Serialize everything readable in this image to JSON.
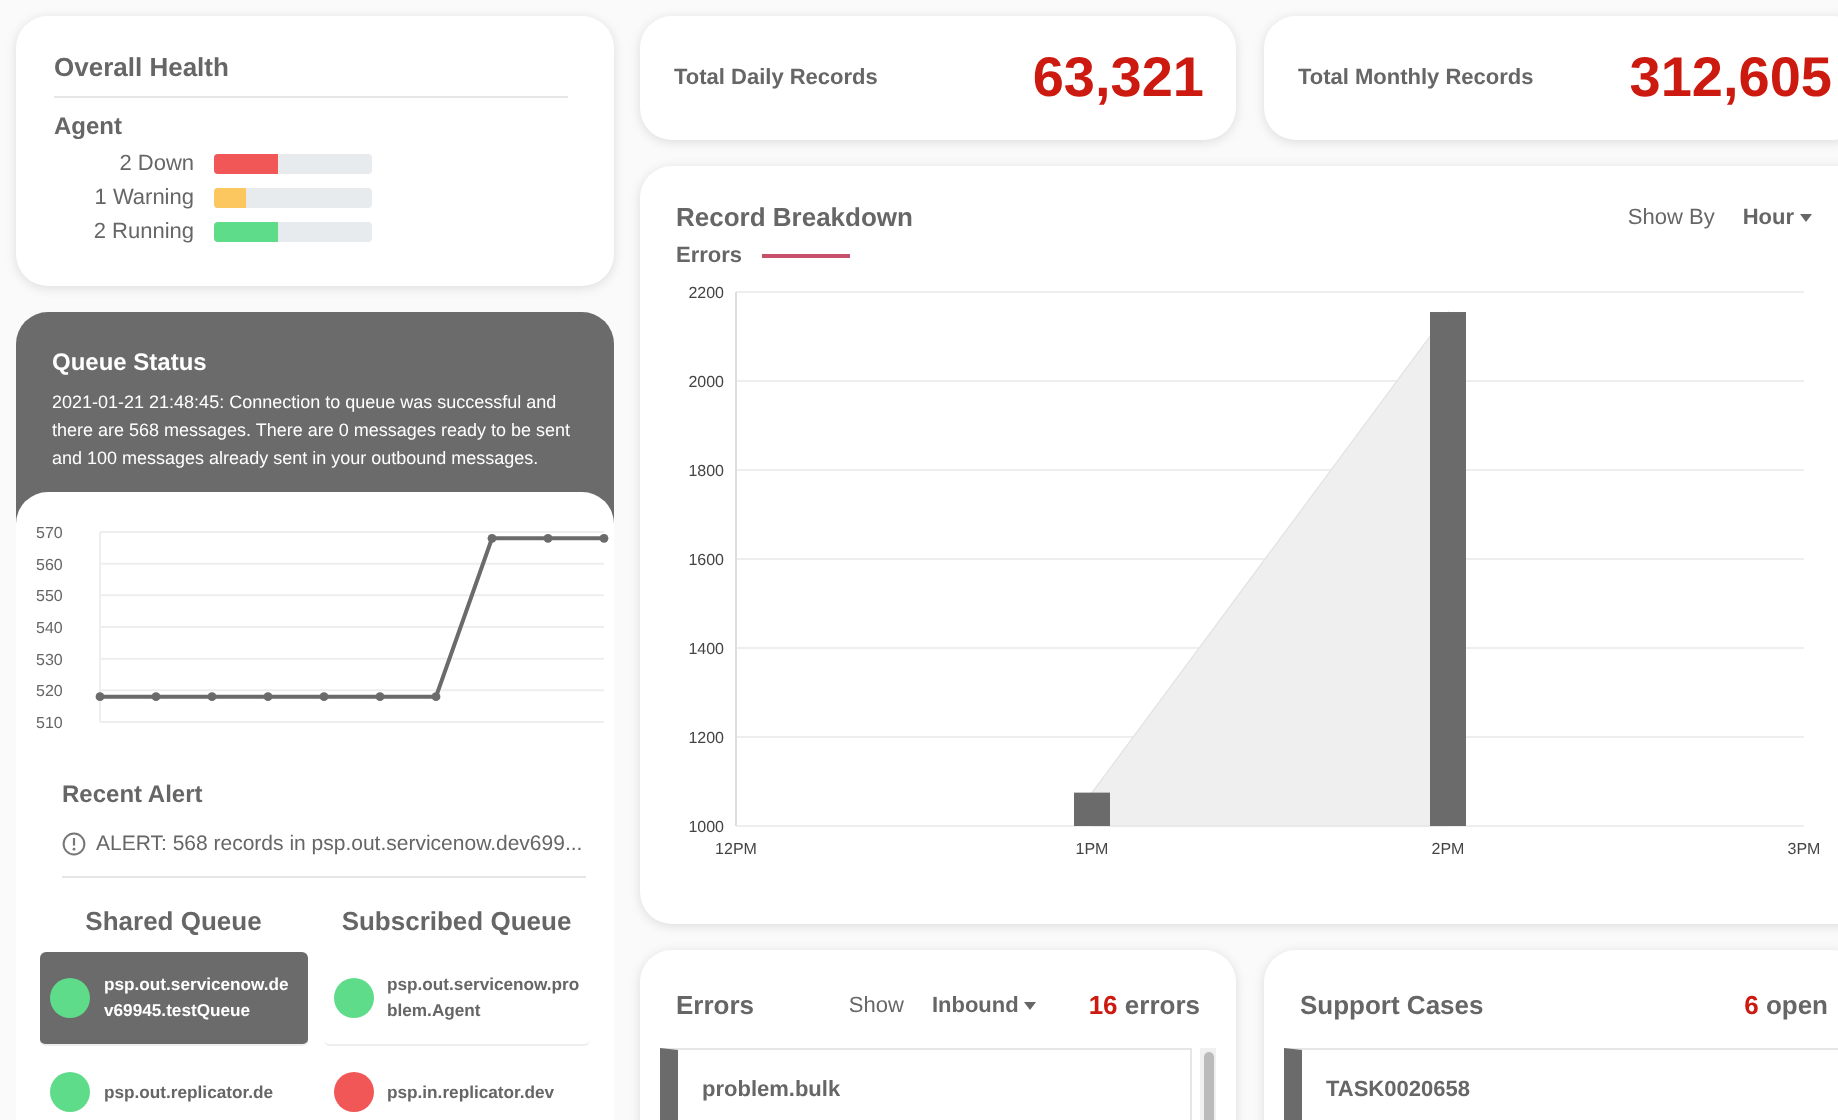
{
  "overall_health": {
    "title": "Overall Health",
    "agent_label": "Agent",
    "agents": [
      {
        "label": "2 Down",
        "level": 0.4,
        "color": "#f25757"
      },
      {
        "label": "1 Warning",
        "level": 0.2,
        "color": "#fbc75e"
      },
      {
        "label": "2 Running",
        "level": 0.4,
        "color": "#5fdc8a"
      }
    ]
  },
  "queue_status": {
    "title": "Queue Status",
    "message": "2021-01-21 21:48:45: Connection to queue was successful and there are 568 messages. There are 0 messages ready to be sent and 100 messages already sent in your outbound messages.",
    "chart_data": {
      "type": "line",
      "grid": true,
      "categories": [
        null,
        null,
        null,
        null,
        null,
        null,
        null,
        null,
        null,
        null
      ],
      "ylim": [
        510,
        570
      ],
      "yticks": [
        510,
        520,
        530,
        540,
        550,
        560,
        570
      ],
      "series": [
        {
          "color": "#6b6b6b",
          "marker": true,
          "values": [
            518,
            518,
            518,
            518,
            518,
            518,
            518,
            568,
            568,
            568
          ]
        }
      ]
    },
    "recent_alert_title": "Recent Alert",
    "alert": "ALERT: 568 records in psp.out.servicenow.dev699...",
    "shared_queue": {
      "title": "Shared Queue",
      "items": [
        {
          "name": "psp.out.servicenow.dev69945.testQueue",
          "selected": true,
          "color": "#5fdc8a"
        },
        {
          "name": "psp.out.replicator.de",
          "selected": false,
          "color": "#5fdc8a"
        }
      ]
    },
    "subscribed_queue": {
      "title": "Subscribed Queue",
      "items": [
        {
          "name": "psp.out.servicenow.problem.Agent",
          "selected": false,
          "color": "#5fdc8a"
        },
        {
          "name": "psp.in.replicator.dev",
          "selected": false,
          "color": "#f25757"
        }
      ]
    }
  },
  "stats": [
    {
      "label": "Total Daily Records",
      "value": "63,321"
    },
    {
      "label": "Total Monthly Records",
      "value": "312,605"
    }
  ],
  "record_breakdown": {
    "title": "Record Breakdown",
    "show_by_label": "Show By",
    "show_by_value": "Hour",
    "chart_data": {
      "type": "bar",
      "grid": true,
      "categories": [
        "12PM",
        "1PM",
        "2PM",
        "3PM"
      ],
      "ylim": [
        1000,
        2200
      ],
      "yticks": [
        1000,
        1200,
        1400,
        1600,
        1800,
        2000,
        2200
      ],
      "series": [
        {
          "name": "Errors",
          "color": "#6b6b6b",
          "values": [
            null,
            1075,
            2155,
            null
          ]
        }
      ]
    }
  },
  "errors": {
    "title": "Errors",
    "show_label": "Show",
    "filter": "Inbound",
    "count": "16",
    "count_label": "errors",
    "items": [
      {
        "title": "problem.bulk"
      }
    ]
  },
  "support_cases": {
    "title": "Support Cases",
    "count": "6",
    "count_label": "open",
    "items": [
      {
        "title": "TASK0020658"
      }
    ]
  }
}
